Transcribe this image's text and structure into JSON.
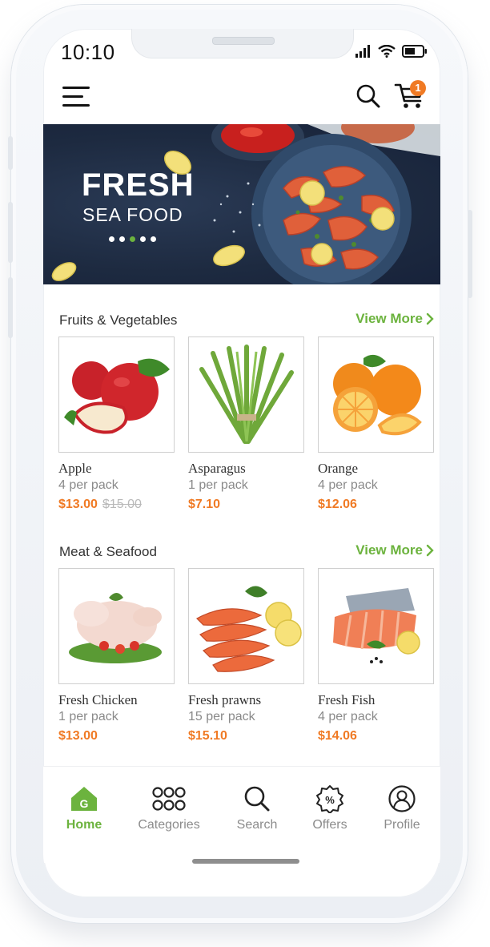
{
  "status_bar": {
    "time": "10:10"
  },
  "header": {
    "cart_count": "1"
  },
  "banner": {
    "title": "FRESH",
    "subtitle": "SEA FOOD",
    "slides": 5,
    "active_slide": 3
  },
  "sections": [
    {
      "title": "Fruits & Vegetables",
      "view_more": "View More",
      "products": [
        {
          "name": "Apple",
          "pack": "4 per pack",
          "price": "$13.00",
          "old_price": "$15.00"
        },
        {
          "name": "Asparagus",
          "pack": "1 per pack",
          "price": "$7.10"
        },
        {
          "name": "Orange",
          "pack": "4 per pack",
          "price": "$12.06"
        }
      ]
    },
    {
      "title": "Meat & Seafood",
      "view_more": "View More",
      "products": [
        {
          "name": "Fresh Chicken",
          "pack": "1 per pack",
          "price": "$13.00"
        },
        {
          "name": "Fresh prawns",
          "pack": "15 per pack",
          "price": "$15.10"
        },
        {
          "name": "Fresh Fish",
          "pack": "4 per pack",
          "price": "$14.06"
        }
      ]
    }
  ],
  "bottom_nav": [
    {
      "label": "Home",
      "icon": "home-icon",
      "active": true
    },
    {
      "label": "Categories",
      "icon": "grid-dots-icon"
    },
    {
      "label": "Search",
      "icon": "search-icon"
    },
    {
      "label": "Offers",
      "icon": "percent-badge-icon"
    },
    {
      "label": "Profile",
      "icon": "user-icon"
    }
  ],
  "colors": {
    "accent_green": "#6cb33e",
    "price_orange": "#f07a24",
    "banner_bg": "#1d2a40"
  }
}
